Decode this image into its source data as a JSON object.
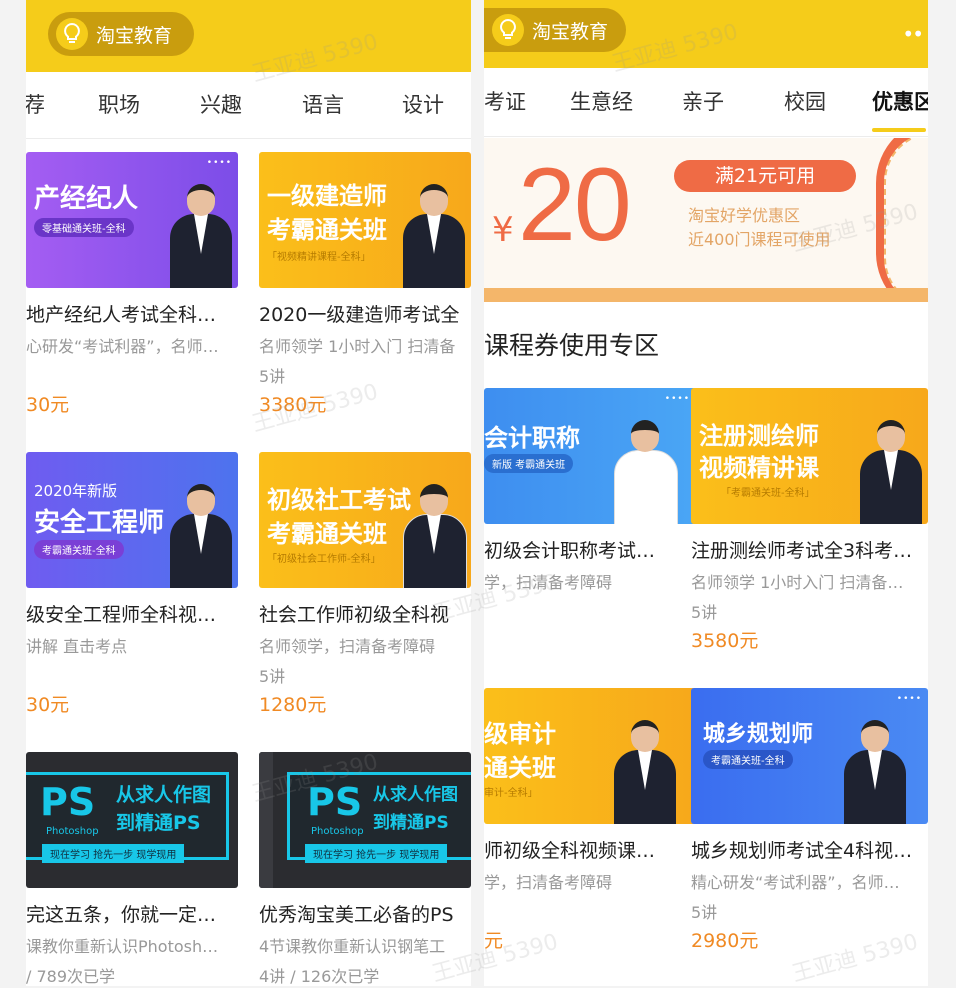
{
  "left": {
    "logo_text": "淘宝教育",
    "tabs": [
      "荐",
      "职场",
      "兴趣",
      "语言",
      "设计"
    ],
    "cards": [
      {
        "thumb_line1": "产经纪人",
        "thumb_pill": "零基础通关班-全科",
        "title": "地产经纪人考试全科…",
        "subtitle": "心研发“考试利器”，名师…",
        "count": "",
        "price": "30元"
      },
      {
        "thumb_line1": "一级建造师",
        "thumb_line2": "考霸通关班",
        "thumb_box": "「视频精讲课程-全科」",
        "title": "2020一级建造师考试全",
        "subtitle": "名师领学 1小时入门 扫清备",
        "count": "5讲",
        "price": "3380元"
      },
      {
        "thumb_top": "2020年新版",
        "thumb_line1": "安全工程师",
        "thumb_pill": "考霸通关班-全科",
        "title": "级安全工程师全科视…",
        "subtitle": "讲解 直击考点",
        "count": "",
        "price": "30元"
      },
      {
        "thumb_line1": "初级社工考试",
        "thumb_line2": "考霸通关班",
        "thumb_box": "「初级社会工作师-全科」",
        "title": "社会工作师初级全科视",
        "subtitle": "名师领学，扫清备考障碍",
        "count": "5讲",
        "price": "1280元"
      },
      {
        "ps": "PS",
        "ps_line1": "从求人作图",
        "ps_line2": "到精通PS",
        "ps_app": "Photoshop",
        "ps_slogan": "现在学习 抢先一步 现学现用",
        "title": "完这五条，你就一定…",
        "subtitle": "课教你重新认识Photosh…",
        "count": "/ 789次已学",
        "price": ""
      },
      {
        "ps": "PS",
        "ps_line1": "从求人作图",
        "ps_line2": "到精通PS",
        "ps_app": "Photoshop",
        "ps_slogan": "现在学习 抢先一步 现学现用",
        "title": "优秀淘宝美工必备的PS",
        "subtitle": "4节课教你重新认识钢笔工",
        "count": "4讲 / 126次已学",
        "price": ""
      }
    ]
  },
  "right": {
    "logo_text": "淘宝教育",
    "more": "••",
    "tabs": [
      "考证",
      "生意经",
      "亲子",
      "校园",
      "优惠区"
    ],
    "active_tab": 4,
    "coupon": {
      "currency": "¥",
      "amount": "20",
      "condition": "满21元可用",
      "line1": "淘宝好学优惠区",
      "line2": "近400门课程可使用"
    },
    "section_title": "课程券使用专区",
    "cards": [
      {
        "thumb_line1": "会计职称",
        "thumb_pill": "新版 考霸通关班",
        "title": "初级会计职称考试…",
        "subtitle": "学，扫清备考障碍",
        "count": "",
        "price": ""
      },
      {
        "thumb_line1": "注册测绘师",
        "thumb_line2": "视频精讲课",
        "thumb_box": "「考霸通关班-全科」",
        "title": "注册测绘师考试全3科考…",
        "subtitle": "名师领学 1小时入门 扫清备…",
        "count": "5讲",
        "price": "3580元"
      },
      {
        "thumb_line1": "级审计",
        "thumb_line2": "通关班",
        "thumb_box": "审计-全科」",
        "title": "师初级全科视频课…",
        "subtitle": "学，扫清备考障碍",
        "count": "",
        "price": "元"
      },
      {
        "thumb_line1": "城乡规划师",
        "thumb_pill": "考霸通关班-全科",
        "title": "城乡规划师考试全4科视…",
        "subtitle": "精心研发“考试利器”，名师…",
        "count": "5讲",
        "price": "2980元"
      }
    ]
  },
  "watermark": "王亚迪 5390",
  "colors": {
    "brand_yellow": "#f5cc1a",
    "price_orange": "#f08a24",
    "coupon_red": "#ef6b45",
    "purple": "#8b5cf6",
    "blue": "#4a7bf0"
  }
}
